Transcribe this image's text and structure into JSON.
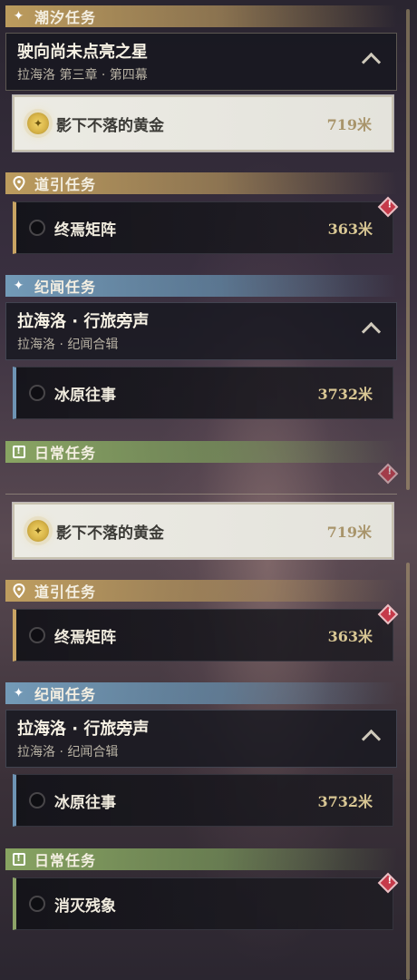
{
  "top": {
    "tide_header": "潮汐任务",
    "chapter": {
      "title": "驶向尚未点亮之星",
      "subtitle": "拉海洛 第三章 · 第四幕"
    },
    "active_quest": {
      "name": "影下不落的黄金",
      "distance": "719米"
    },
    "guide_header": "道引任务",
    "guide_quest": {
      "name": "终焉矩阵",
      "distance": "363米"
    },
    "chronicle_header": "纪闻任务",
    "chronicle": {
      "title": "拉海洛 · 行旅旁声",
      "subtitle": "拉海洛 · 纪闻合辑"
    },
    "chronicle_quest": {
      "name": "冰原往事",
      "distance": "3732米"
    },
    "daily_header": "日常任务"
  },
  "bottom": {
    "active_quest": {
      "name": "影下不落的黄金",
      "distance": "719米"
    },
    "guide_header": "道引任务",
    "guide_quest": {
      "name": "终焉矩阵",
      "distance": "363米"
    },
    "chronicle_header": "纪闻任务",
    "chronicle": {
      "title": "拉海洛 · 行旅旁声",
      "subtitle": "拉海洛 · 纪闻合辑"
    },
    "chronicle_quest": {
      "name": "冰原往事",
      "distance": "3732米"
    },
    "daily_header": "日常任务",
    "daily_quest": {
      "name": "消灭残象"
    }
  },
  "icons": {
    "tide": "sparkle-icon",
    "guide": "location-pin-icon",
    "chronicle": "sparkle-icon",
    "daily": "exclamation-box-icon",
    "alert": "warning-diamond-icon",
    "collapse": "chevron-up-icon",
    "tracked": "compass-icon"
  },
  "colors": {
    "tide_header": "#c4a260",
    "guide_header": "#c4a260",
    "chronicle_header": "#76a0be",
    "daily_header": "#8caa64",
    "distance": "#d9c794",
    "alert": "#c53a4a"
  }
}
